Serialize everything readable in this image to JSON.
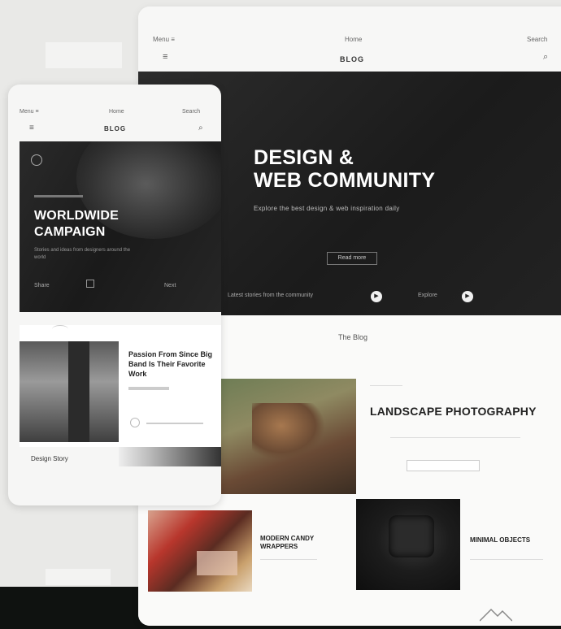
{
  "tablet": {
    "nav": {
      "left_mini": "Menu ≡",
      "center_mini": "Home",
      "right_mini": "Search",
      "logo": "BLOG"
    },
    "hero": {
      "title_line1": "DESIGN &",
      "title_line2": "WEB COMMUNITY",
      "subtitle": "Explore the best design & web inspiration daily",
      "cta": "Read more",
      "meta_left": "Latest stories from the community",
      "meta_right": "Explore"
    },
    "blog": {
      "title": "The Blog",
      "feature_title": "LANDSCAPE PHOTOGRAPHY",
      "card_left_title": "Modern Candy Wrappers",
      "card_right_title": "Minimal Objects"
    }
  },
  "phone": {
    "nav": {
      "left_mini": "Menu ≡",
      "center_mini": "Home",
      "right_mini": "Search",
      "logo": "BLOG"
    },
    "hero": {
      "title_line1": "WORLDWIDE",
      "title_line2": "CAMPAIGN",
      "description": "Stories and ideas from designers around the world",
      "foot_left": "Share",
      "foot_right": "Next"
    },
    "card": {
      "title": "Passion From Since Big Band Is Their Favorite Work",
      "caption": "Design Story"
    }
  },
  "colors": {
    "hero_dark": "#1f1f1f",
    "page_bg": "#e9e9e7",
    "bottom_bar": "#0f1210"
  }
}
